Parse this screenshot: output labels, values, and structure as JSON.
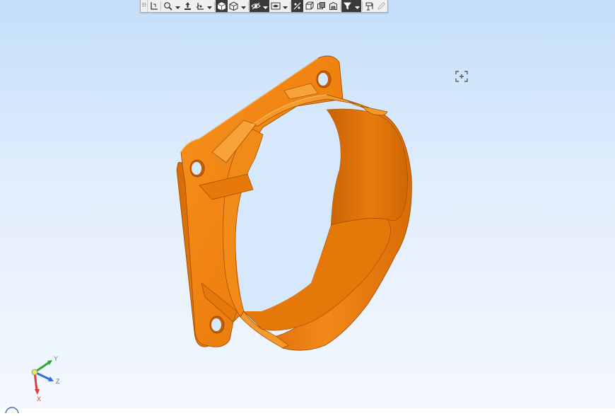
{
  "app": {
    "background_top": "#c4defa",
    "background_bottom": "#f4f8fe",
    "part_color": "#f07d0f",
    "part_shadow_color": "#c05f05"
  },
  "toolbar": {
    "items": [
      {
        "name": "toolbar-grip",
        "icon": "grip-icon"
      },
      {
        "name": "coordinate-system-button",
        "icon": "axes-icon"
      },
      {
        "name": "zoom-button",
        "icon": "zoom-icon",
        "dropdown": true
      },
      {
        "name": "pan-button",
        "icon": "pan-icon"
      },
      {
        "name": "rotate-button",
        "icon": "rotate-icon",
        "dropdown": true
      },
      {
        "name": "view-shaded-button",
        "icon": "shaded-cube-icon",
        "active": true
      },
      {
        "name": "view-orientation-button",
        "icon": "iso-cube-icon",
        "dropdown": true
      },
      {
        "name": "display-mode-button",
        "icon": "eye-icon",
        "dropdown": true,
        "active": true
      },
      {
        "name": "hide-show-button",
        "icon": "hide-show-icon",
        "dropdown": true
      },
      {
        "name": "section-button",
        "icon": "section-icon",
        "active": true
      },
      {
        "name": "view-front-button",
        "icon": "view-front-icon"
      },
      {
        "name": "view-copy-button",
        "icon": "view-copy-icon"
      },
      {
        "name": "view-layout-button",
        "icon": "view-layout-icon"
      },
      {
        "name": "filter-button",
        "icon": "filter-icon",
        "dropdown": true,
        "active": true
      },
      {
        "name": "measure-button",
        "icon": "measure-icon"
      },
      {
        "name": "edit-pen-button",
        "icon": "pen-icon",
        "disabled": true
      }
    ]
  },
  "triad": {
    "x_label": "X",
    "y_label": "Y",
    "z_label": "Z",
    "x_color": "#e03c3c",
    "y_color": "#2fa82f",
    "z_color": "#2f6fd6"
  }
}
